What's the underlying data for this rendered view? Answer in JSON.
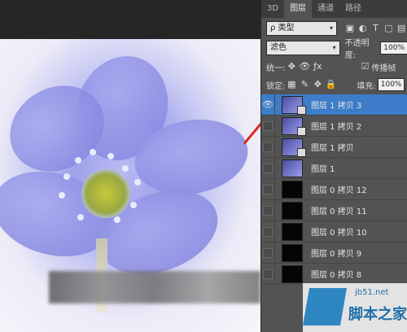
{
  "panel": {
    "tabs": [
      "3D",
      "图层",
      "通道",
      "路径"
    ],
    "active_tab": "图层",
    "filter_label": "ρ 类型",
    "filter_icons": [
      "image-icon",
      "circle-half-icon",
      "type-icon",
      "shape-icon",
      "smart-object-icon"
    ],
    "blend_mode": "滤色",
    "opacity_label": "不透明度:",
    "opacity_value": "100%",
    "unify_label": "统一:",
    "propagate_label": "传播帧",
    "lock_label": "锁定:",
    "fill_label": "填充:",
    "fill_value": "100%"
  },
  "layers": [
    {
      "name": "图层 1 拷贝 3",
      "visible": true,
      "selected": true,
      "thumb": "image"
    },
    {
      "name": "图层 1 拷贝 2",
      "visible": false,
      "selected": false,
      "thumb": "image"
    },
    {
      "name": "图层 1 拷贝",
      "visible": false,
      "selected": false,
      "thumb": "image"
    },
    {
      "name": "图层 1",
      "visible": false,
      "selected": false,
      "thumb": "image"
    },
    {
      "name": "图层 0 拷贝 12",
      "visible": false,
      "selected": false,
      "thumb": "black"
    },
    {
      "name": "图层 0 拷贝 11",
      "visible": false,
      "selected": false,
      "thumb": "black"
    },
    {
      "name": "图层 0 拷贝 10",
      "visible": false,
      "selected": false,
      "thumb": "black"
    },
    {
      "name": "图层 0 拷贝 9",
      "visible": false,
      "selected": false,
      "thumb": "black"
    },
    {
      "name": "图层 0 拷贝 8",
      "visible": false,
      "selected": false,
      "thumb": "black"
    }
  ],
  "watermark": {
    "url": "jb51.net",
    "name": "脚本之家"
  },
  "colors": {
    "selected_layer": "#3d7cc9",
    "arrow": "#e0261f",
    "panel": "#535353"
  }
}
